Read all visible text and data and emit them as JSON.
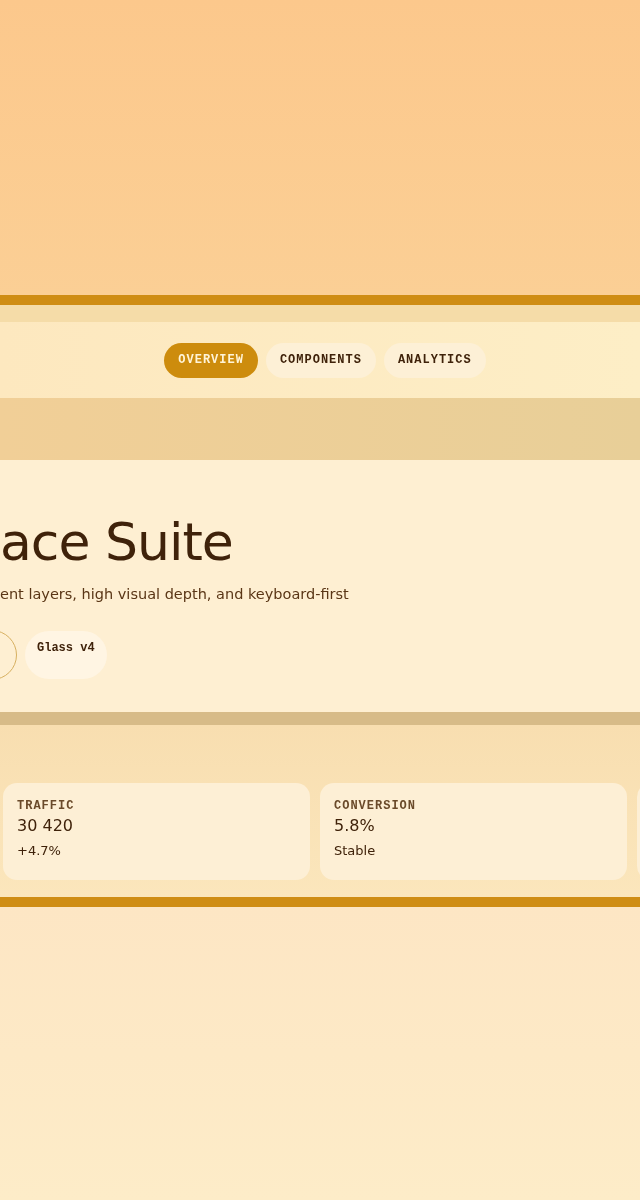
{
  "tabs": [
    {
      "label": "OVERVIEW",
      "selected": true
    },
    {
      "label": "COMPONENTS",
      "selected": false
    },
    {
      "label": "ANALYTICS",
      "selected": false
    }
  ],
  "hero": {
    "title": "ace Suite",
    "subtitle": "ent layers, high visual depth, and keyboard-first",
    "tag": "Glass v4"
  },
  "stats": [
    {
      "label": "TRAFFIC",
      "value": "30 420",
      "note": "+4.7%"
    },
    {
      "label": "CONVERSION",
      "value": "5.8%",
      "note": "Stable"
    }
  ]
}
